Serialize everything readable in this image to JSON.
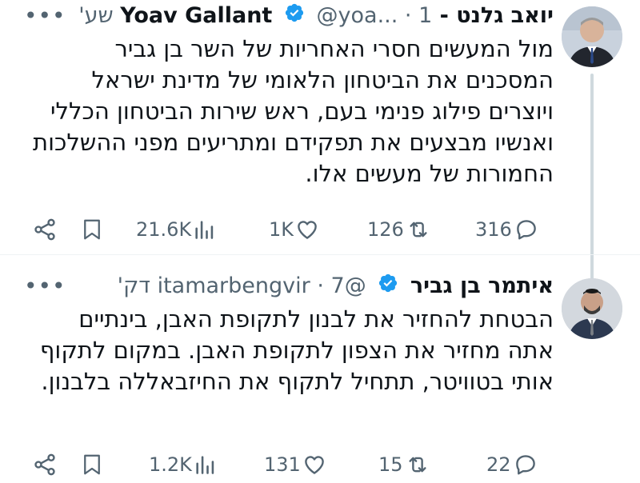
{
  "tweets": [
    {
      "author_name": "יואב גלנט - Yoav Gallant",
      "handle": "@yoa...",
      "time": "1 שע'",
      "text": "מול המעשים חסרי האחריות של השר בן גביר המסכנים את הביטחון הלאומי של מדינת ישראל ויוצרים פילוג פנימי בעם, ראש שירות הביטחון הכללי ואנשיו מבצעים את תפקידם ומתריעים מפני ההשלכות החמורות של מעשים אלו.",
      "views": "21.6K",
      "likes": "1K",
      "retweets": "126",
      "replies": "316"
    },
    {
      "author_name": "איתמר בן גביר",
      "handle": "@itamarbengvir",
      "time": "7 דק'",
      "text": "הבטחת להחזיר את לבנון לתקופת האבן, בינתיים אתה מחזיר את הצפון לתקופת האבן. במקום לתקוף אותי בטוויטר, תתחיל לתקוף את החיזבאללה בלבנון.",
      "views": "1.2K",
      "likes": "131",
      "retweets": "15",
      "replies": "22"
    }
  ],
  "colors": {
    "verified": "#1d9bf0",
    "muted": "#536471",
    "text": "#0f1419"
  },
  "icons": [
    "more-icon",
    "verified-icon",
    "share-icon",
    "bookmark-icon",
    "views-icon",
    "like-icon",
    "retweet-icon",
    "reply-icon"
  ]
}
